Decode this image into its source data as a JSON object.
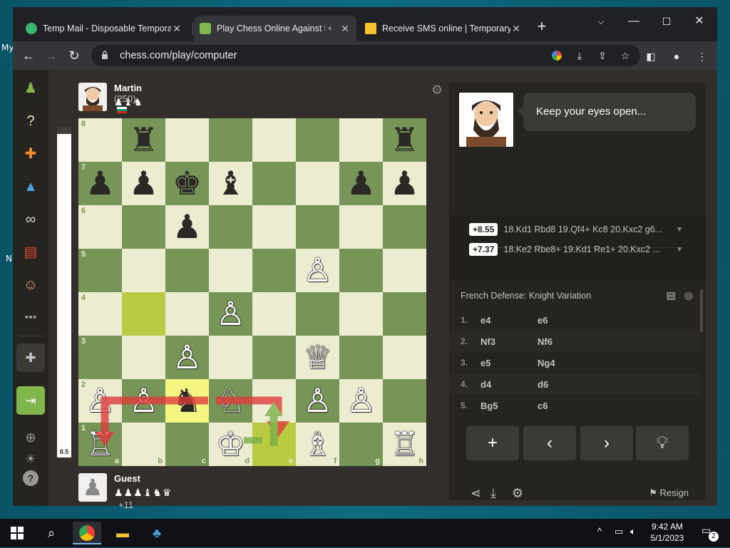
{
  "browser": {
    "tabs": [
      {
        "title": "Temp Mail - Disposable Temporary Email",
        "favicon_color": "#3cb371"
      },
      {
        "title": "Play Chess Online Against the Computer",
        "favicon_color": "#81b64c",
        "active": true
      },
      {
        "title": "Receive SMS online | Temporary Phone",
        "favicon_color": "#f4c430"
      }
    ],
    "url": "chess.com/play/computer"
  },
  "opponent": {
    "name": "Martin",
    "rating": "(250)",
    "captured": "♟♝♞"
  },
  "player": {
    "name": "Guest",
    "captured": "♟♟♟♝♞♛",
    "advantage": "+11"
  },
  "eval": "8.5",
  "board": {
    "files": [
      "a",
      "b",
      "c",
      "d",
      "e",
      "f",
      "g",
      "h"
    ],
    "ranks": [
      "8",
      "7",
      "6",
      "5",
      "4",
      "3",
      "2",
      "1"
    ],
    "pieces": [
      {
        "sq": "b8",
        "p": "♜",
        "c": "b"
      },
      {
        "sq": "h8",
        "p": "♜",
        "c": "b"
      },
      {
        "sq": "a7",
        "p": "♟",
        "c": "b"
      },
      {
        "sq": "b7",
        "p": "♟",
        "c": "b"
      },
      {
        "sq": "c7",
        "p": "♚",
        "c": "b"
      },
      {
        "sq": "d7",
        "p": "♝",
        "c": "b"
      },
      {
        "sq": "g7",
        "p": "♟",
        "c": "b"
      },
      {
        "sq": "h7",
        "p": "♟",
        "c": "b"
      },
      {
        "sq": "c6",
        "p": "♟",
        "c": "b"
      },
      {
        "sq": "f5",
        "p": "♙",
        "c": "w"
      },
      {
        "sq": "d4",
        "p": "♙",
        "c": "w"
      },
      {
        "sq": "c3",
        "p": "♙",
        "c": "w"
      },
      {
        "sq": "f3",
        "p": "♕",
        "c": "w"
      },
      {
        "sq": "a2",
        "p": "♙",
        "c": "w"
      },
      {
        "sq": "b2",
        "p": "♙",
        "c": "w"
      },
      {
        "sq": "c2",
        "p": "♞",
        "c": "b"
      },
      {
        "sq": "d2",
        "p": "♘",
        "c": "w"
      },
      {
        "sq": "f2",
        "p": "♙",
        "c": "w"
      },
      {
        "sq": "g2",
        "p": "♙",
        "c": "w"
      },
      {
        "sq": "a1",
        "p": "♖",
        "c": "w"
      },
      {
        "sq": "d1",
        "p": "♔",
        "c": "w"
      },
      {
        "sq": "f1",
        "p": "♗",
        "c": "w"
      },
      {
        "sq": "h1",
        "p": "♖",
        "c": "w"
      }
    ],
    "highlights": [
      "b4",
      "c2",
      "e1"
    ]
  },
  "coach": {
    "message": "Keep your eyes open..."
  },
  "lines": [
    {
      "eval": "+8.55",
      "moves": "18.Kd1 Rbd8 19.Qf4+ Kc8 20.Kxc2 g6..."
    },
    {
      "eval": "+7.37",
      "moves": "18.Ke2 Rbe8+ 19.Kd1 Re1+ 20.Kxc2 ..."
    }
  ],
  "opening": "French Defense: Knight Variation",
  "moves": [
    {
      "n": "1.",
      "w": "e4",
      "b": "e6"
    },
    {
      "n": "2.",
      "w": "Nf3",
      "b": "Nf6"
    },
    {
      "n": "3.",
      "w": "e5",
      "b": "Ng4"
    },
    {
      "n": "4.",
      "w": "d4",
      "b": "d6"
    },
    {
      "n": "5.",
      "w": "Bg5",
      "b": "c6"
    }
  ],
  "controls": {
    "resign": "Resign"
  },
  "taskbar": {
    "time": "9:42 AM",
    "date": "5/1/2023",
    "notifications": "2"
  },
  "desktop_fragments": [
    "My",
    "N"
  ]
}
